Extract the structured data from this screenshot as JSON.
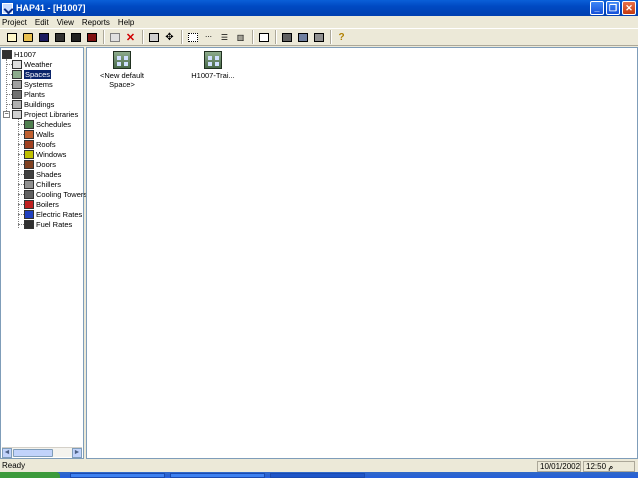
{
  "window": {
    "title": "HAP41 - [H1007]",
    "controls": {
      "minimize": "_",
      "restore": "❐",
      "close": "✕"
    }
  },
  "menu": [
    "Project",
    "Edit",
    "View",
    "Reports",
    "Help"
  ],
  "toolbar": {
    "icons": [
      "new-project-icon",
      "open-project-icon",
      "save-icon",
      "archive-icon",
      "print-icon",
      "print-report-icon",
      "copy-icon",
      "delete-icon",
      "properties-icon",
      "move-icon",
      "large-icons-icon",
      "small-icons-icon",
      "list-icon",
      "details-icon",
      "input-sheet-icon",
      "calculate-icon",
      "results-chart-icon",
      "report-icon",
      "help-icon"
    ]
  },
  "tree": {
    "root": "H1007",
    "items": [
      {
        "label": "Weather"
      },
      {
        "label": "Spaces",
        "selected": true
      },
      {
        "label": "Systems"
      },
      {
        "label": "Plants"
      },
      {
        "label": "Buildings"
      }
    ],
    "libraries": {
      "label": "Project Libraries",
      "expander": "−",
      "items": [
        "Schedules",
        "Walls",
        "Roofs",
        "Windows",
        "Doors",
        "Shades",
        "Chillers",
        "Cooling Towers",
        "Boilers",
        "Electric Rates",
        "Fuel Rates"
      ]
    },
    "scroll": {
      "left": "◄",
      "right": "►"
    }
  },
  "content": {
    "items": [
      {
        "label_line1": "<New default",
        "label_line2": "Space>"
      },
      {
        "label_line1": "H1007-Trai...",
        "label_line2": ""
      }
    ]
  },
  "status": {
    "text": "Ready",
    "date": "10/01/2002",
    "time": "12:50 م"
  },
  "colors": {
    "titlebar": "#0049c2",
    "selection": "#0a246a",
    "workspace": "#ffffff",
    "chrome": "#ece9d8"
  }
}
